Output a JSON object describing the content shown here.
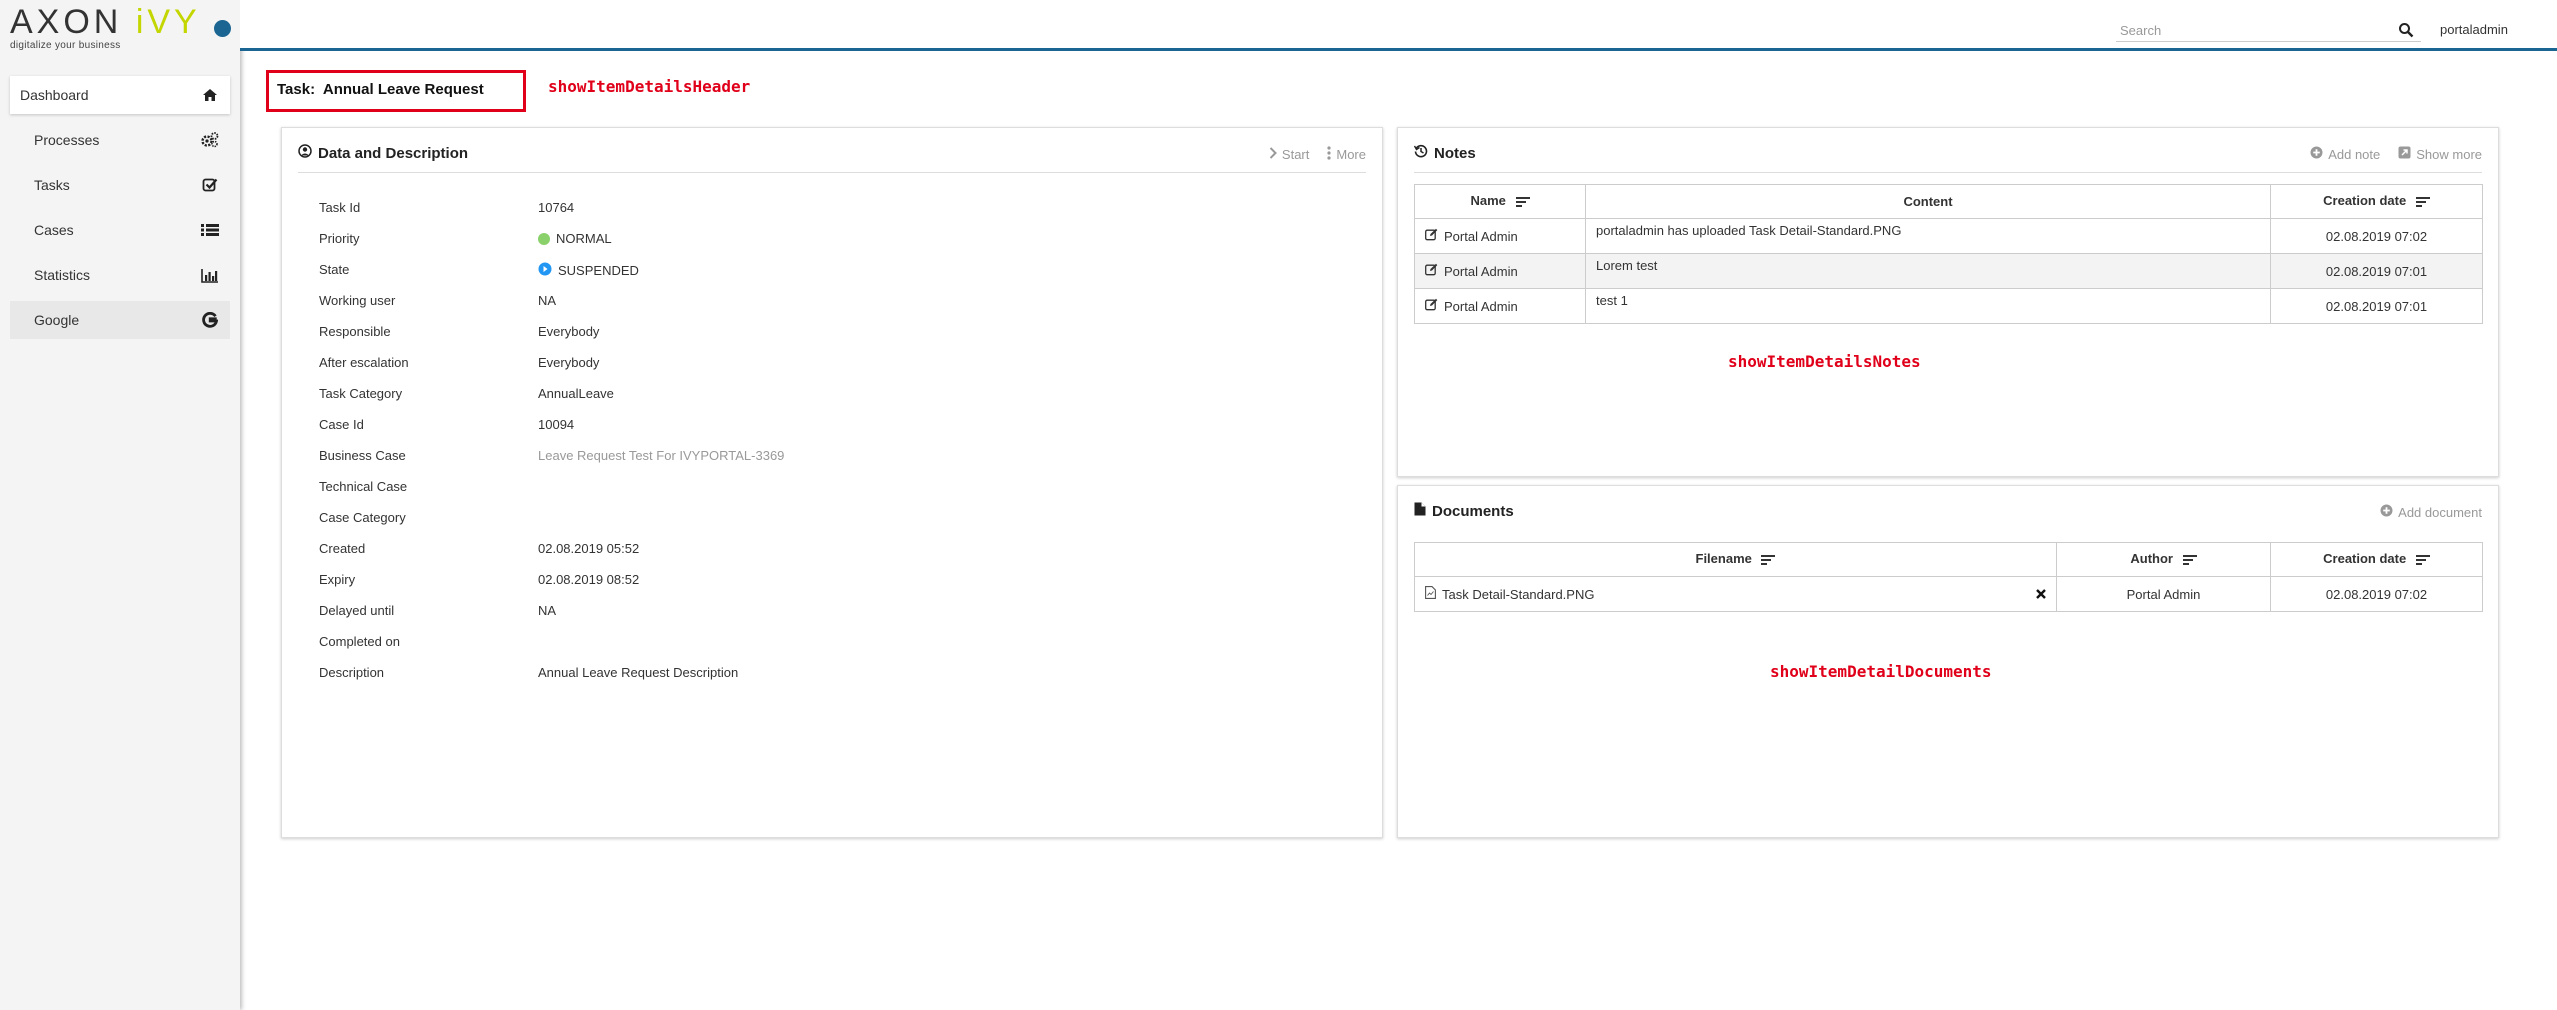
{
  "logo": {
    "brand_part1": "AXON",
    "brand_part2": "iVY",
    "tagline": "digitalize your business"
  },
  "sidebar": {
    "items": [
      {
        "label": "Dashboard",
        "icon": "home-icon"
      },
      {
        "label": "Processes",
        "icon": "gears-icon"
      },
      {
        "label": "Tasks",
        "icon": "check-square-icon"
      },
      {
        "label": "Cases",
        "icon": "list-icon"
      },
      {
        "label": "Statistics",
        "icon": "bar-chart-icon"
      },
      {
        "label": "Google",
        "icon": "google-icon"
      }
    ]
  },
  "topbar": {
    "search_placeholder": "Search",
    "username": "portaladmin"
  },
  "header": {
    "prefix": "Task:",
    "title": "Annual Leave Request"
  },
  "annotations": {
    "header": "showItemDetailsHeader",
    "notes": "showItemDetailsNotes",
    "documents": "showItemDetailDocuments"
  },
  "data_panel": {
    "title": "Data and Description",
    "actions": {
      "start": "Start",
      "more": "More"
    },
    "rows": [
      {
        "label": "Task Id",
        "value": "10764"
      },
      {
        "label": "Priority",
        "value": "NORMAL",
        "indicator": "#8bd16b"
      },
      {
        "label": "State",
        "value": "SUSPENDED",
        "indicator": "#2196f3"
      },
      {
        "label": "Working user",
        "value": "NA"
      },
      {
        "label": "Responsible",
        "value": "Everybody"
      },
      {
        "label": "After escalation",
        "value": "Everybody"
      },
      {
        "label": "Task Category",
        "value": "AnnualLeave"
      },
      {
        "label": "Case Id",
        "value": "10094"
      },
      {
        "label": "Business Case",
        "value": "Leave Request Test For IVYPORTAL-3369",
        "muted": true
      },
      {
        "label": "Technical Case",
        "value": ""
      },
      {
        "label": "Case Category",
        "value": ""
      },
      {
        "label": "Created",
        "value": "02.08.2019 05:52"
      },
      {
        "label": "Expiry",
        "value": "02.08.2019 08:52"
      },
      {
        "label": "Delayed until",
        "value": "NA"
      },
      {
        "label": "Completed on",
        "value": ""
      },
      {
        "label": "Description",
        "value": "Annual Leave Request Description"
      }
    ]
  },
  "notes_panel": {
    "title": "Notes",
    "actions": {
      "add": "Add note",
      "show_more": "Show more"
    },
    "columns": [
      "Name",
      "Content",
      "Creation date"
    ],
    "rows": [
      {
        "name": "Portal Admin",
        "content": "portaladmin has uploaded Task Detail-Standard.PNG",
        "date": "02.08.2019 07:02"
      },
      {
        "name": "Portal Admin",
        "content": "Lorem test",
        "date": "02.08.2019 07:01"
      },
      {
        "name": "Portal Admin",
        "content": "test 1",
        "date": "02.08.2019 07:01"
      }
    ]
  },
  "documents_panel": {
    "title": "Documents",
    "actions": {
      "add": "Add document"
    },
    "columns": [
      "Filename",
      "Author",
      "Creation date"
    ],
    "rows": [
      {
        "filename": "Task Detail-Standard.PNG",
        "author": "Portal Admin",
        "date": "02.08.2019 07:02"
      }
    ]
  },
  "colors": {
    "accent": "#1b6593",
    "annotation": "#e0001a",
    "logo_green": "#c4d600"
  }
}
